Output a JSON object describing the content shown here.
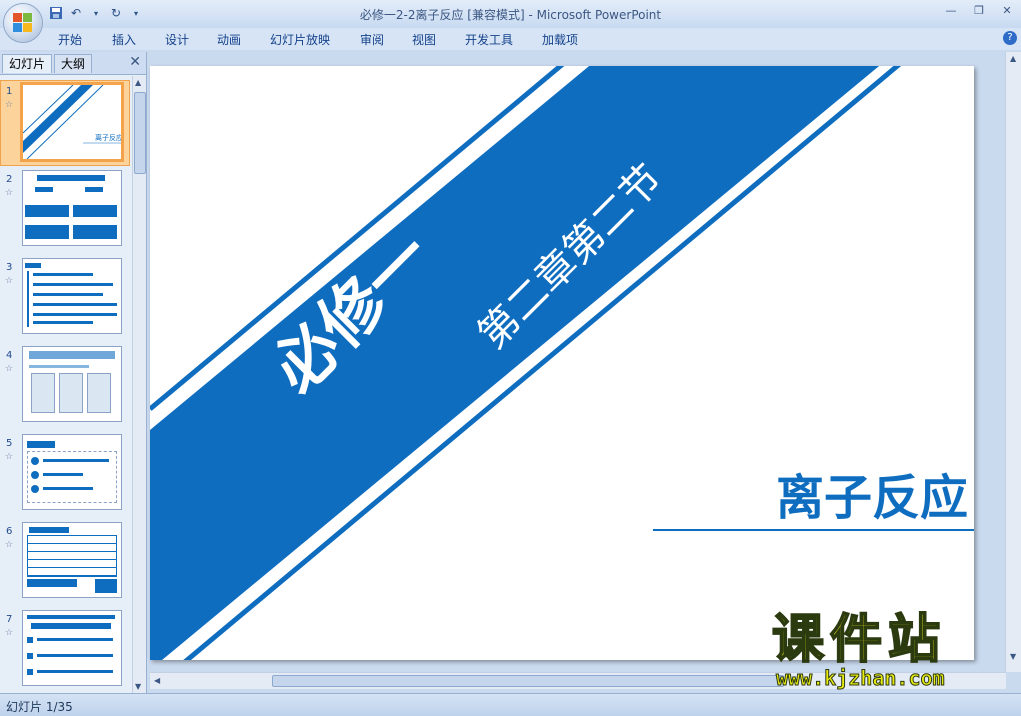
{
  "window": {
    "title": "必修一2-2离子反应 [兼容模式] - Microsoft PowerPoint"
  },
  "ribbon_tabs": [
    "开始",
    "插入",
    "设计",
    "动画",
    "幻灯片放映",
    "审阅",
    "视图",
    "开发工具",
    "加载项"
  ],
  "panel": {
    "tabs": [
      "幻灯片",
      "大纲"
    ]
  },
  "thumbnails": [
    {
      "num": "1",
      "selected": true
    },
    {
      "num": "2"
    },
    {
      "num": "3"
    },
    {
      "num": "4"
    },
    {
      "num": "5"
    },
    {
      "num": "6"
    },
    {
      "num": "7"
    }
  ],
  "slide": {
    "book": "必修一",
    "chapter": "第二章第二节",
    "title": "离子反应"
  },
  "watermark": {
    "name": "课件站",
    "url": "www.kjzhan.com"
  },
  "status": {
    "slide_count": "幻灯片 1/35"
  },
  "colors": {
    "accent": "#0f6dc0",
    "brand_yellow": "#e8ea10"
  }
}
